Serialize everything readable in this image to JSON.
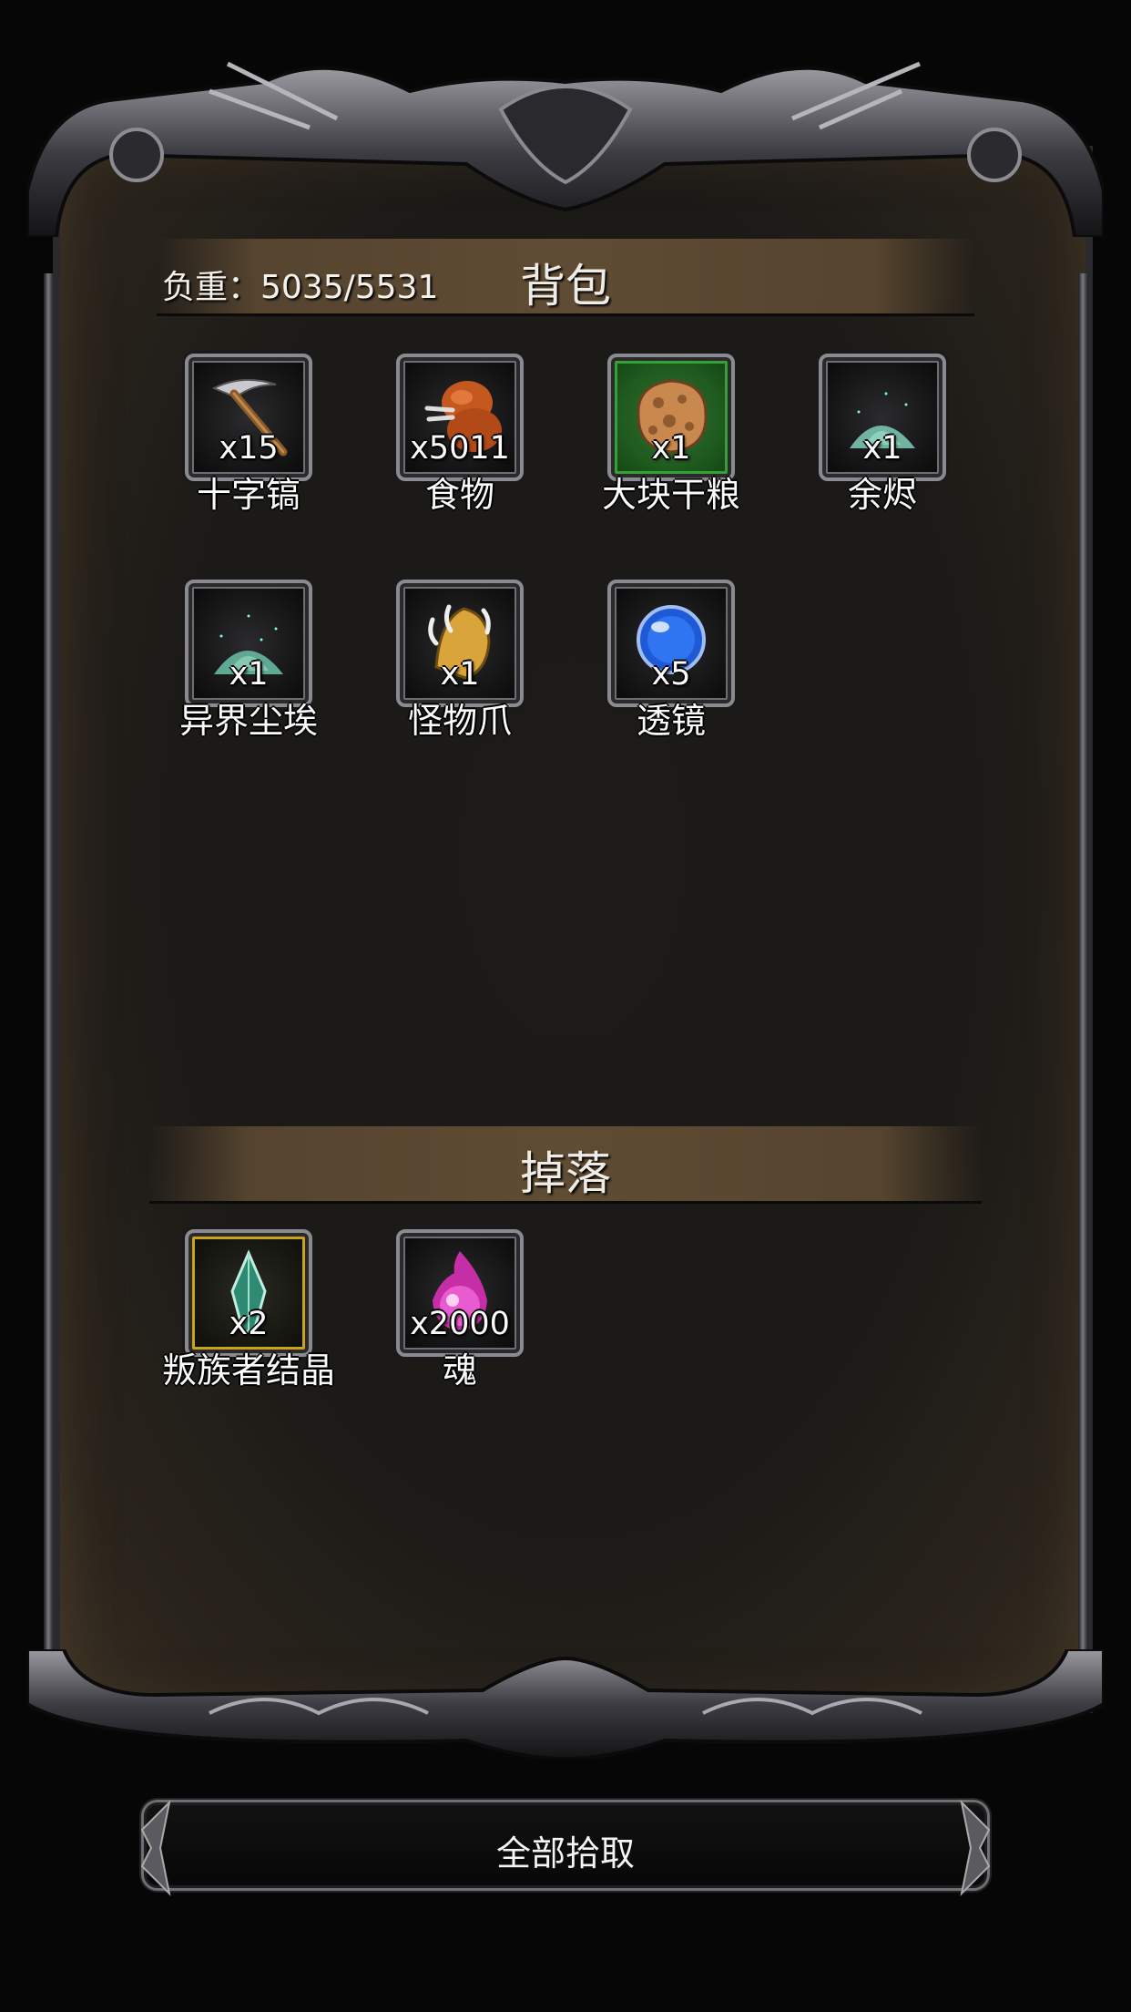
{
  "backpack": {
    "title": "背包",
    "weight_label": "负重：5035/5531",
    "items": [
      {
        "name": "十字镐",
        "qty": "x15",
        "icon": "pickaxe-icon",
        "frame": "normal"
      },
      {
        "name": "食物",
        "qty": "x5011",
        "icon": "meat-icon",
        "frame": "normal"
      },
      {
        "name": "大块干粮",
        "qty": "x1",
        "icon": "bread-icon",
        "frame": "green"
      },
      {
        "name": "余烬",
        "qty": "x1",
        "icon": "ash-pile-icon",
        "frame": "normal"
      },
      {
        "name": "异界尘埃",
        "qty": "x1",
        "icon": "dust-pile-icon",
        "frame": "normal"
      },
      {
        "name": "怪物爪",
        "qty": "x1",
        "icon": "monster-claw-icon",
        "frame": "normal"
      },
      {
        "name": "透镜",
        "qty": "x5",
        "icon": "lens-orb-icon",
        "frame": "normal"
      }
    ]
  },
  "drops": {
    "title": "掉落",
    "items": [
      {
        "name": "叛族者结晶",
        "qty": "x2",
        "icon": "crystal-shard-icon",
        "frame": "gold"
      },
      {
        "name": "魂",
        "qty": "x2000",
        "icon": "soul-flame-icon",
        "frame": "normal"
      }
    ]
  },
  "pickup_all": {
    "label": "全部拾取"
  },
  "colors": {
    "panel_bg": "#1c1a17",
    "header_band": "#5f4c34",
    "rare_green": "#35a035",
    "rare_gold": "#c9a21e"
  }
}
